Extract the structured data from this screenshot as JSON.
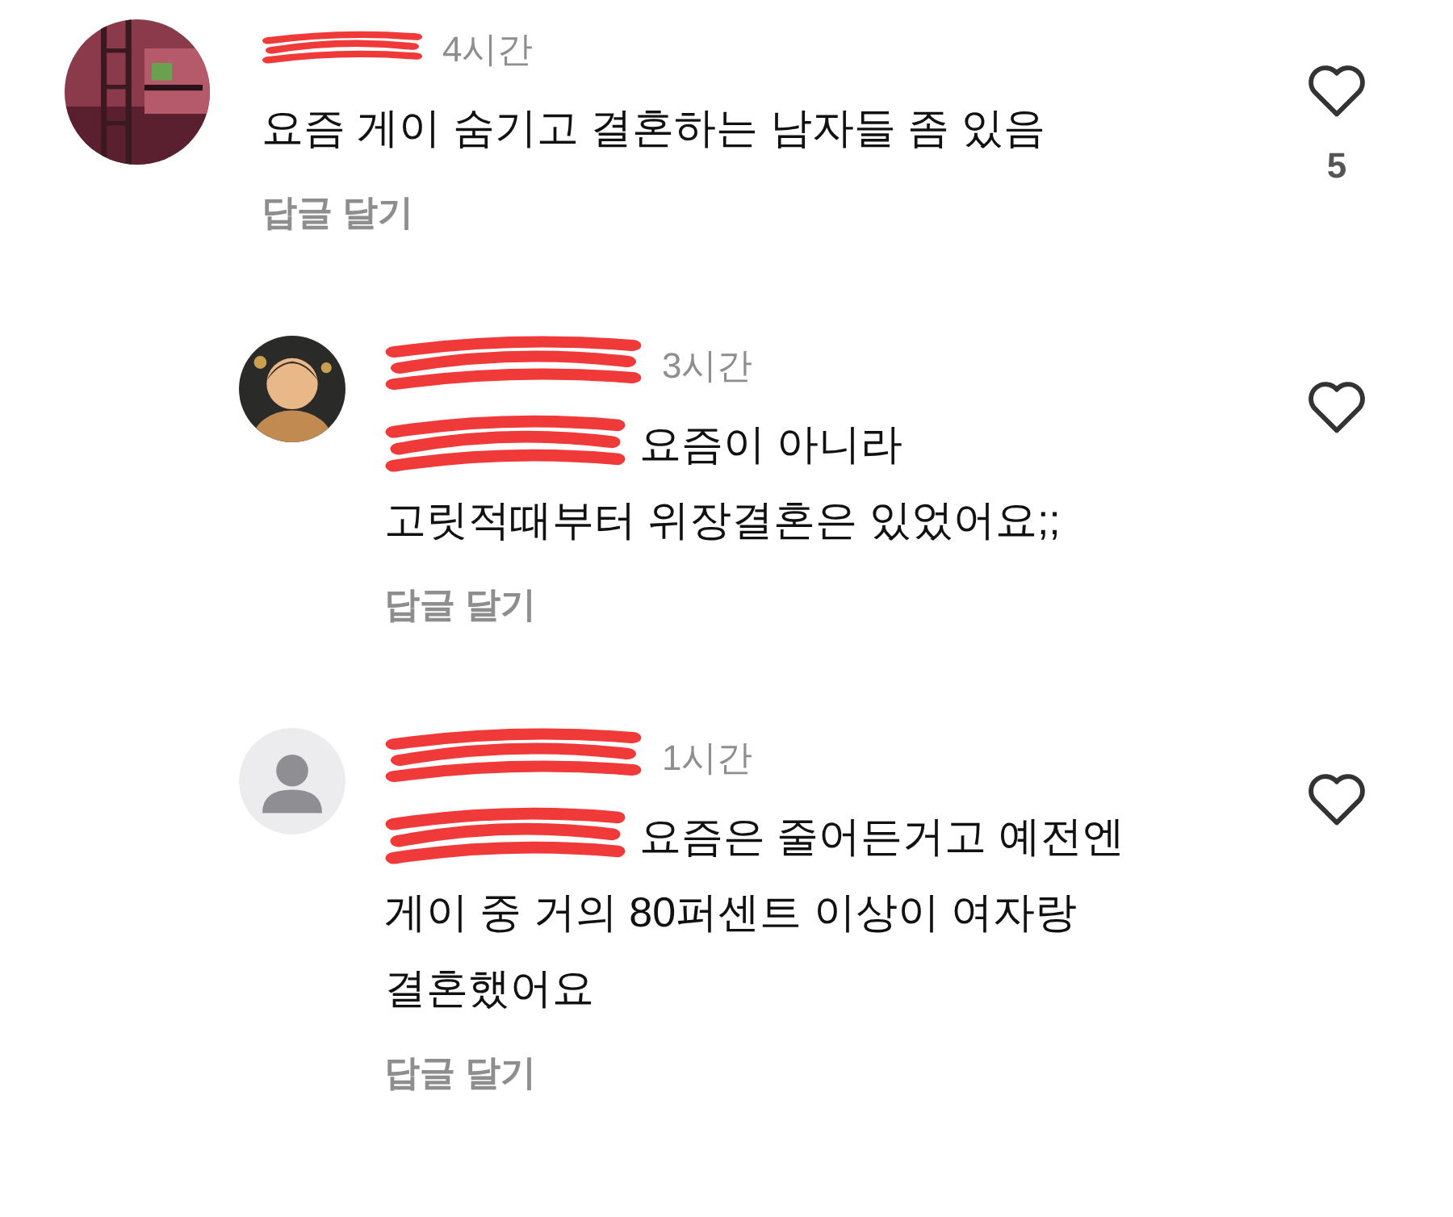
{
  "comments": [
    {
      "avatar": {
        "kind": "picture"
      },
      "name_redacted": true,
      "time": "4시간",
      "lines": [
        "요즘 게이 숨기고 결혼하는 남자들 좀 있음"
      ],
      "reply_label": "답글 달기",
      "liked": false,
      "likes": "5",
      "children": [
        {
          "avatar": {
            "kind": "figure"
          },
          "name_redacted": true,
          "time": "3시간",
          "lines": [
            "요즘이 아니라",
            "고릿적때부터 위장결혼은 있었어요;;"
          ],
          "mention_redacted": true,
          "reply_label": "답글 달기",
          "liked": false
        },
        {
          "avatar": {
            "kind": "default"
          },
          "name_redacted": true,
          "time": "1시간",
          "lines": [
            "요즘은 줄어든거고 예전엔",
            "게이 중 거의 80퍼센트 이상이 여자랑",
            "결혼했어요"
          ],
          "mention_redacted": true,
          "reply_label": "답글 달기",
          "liked": false
        }
      ]
    }
  ]
}
